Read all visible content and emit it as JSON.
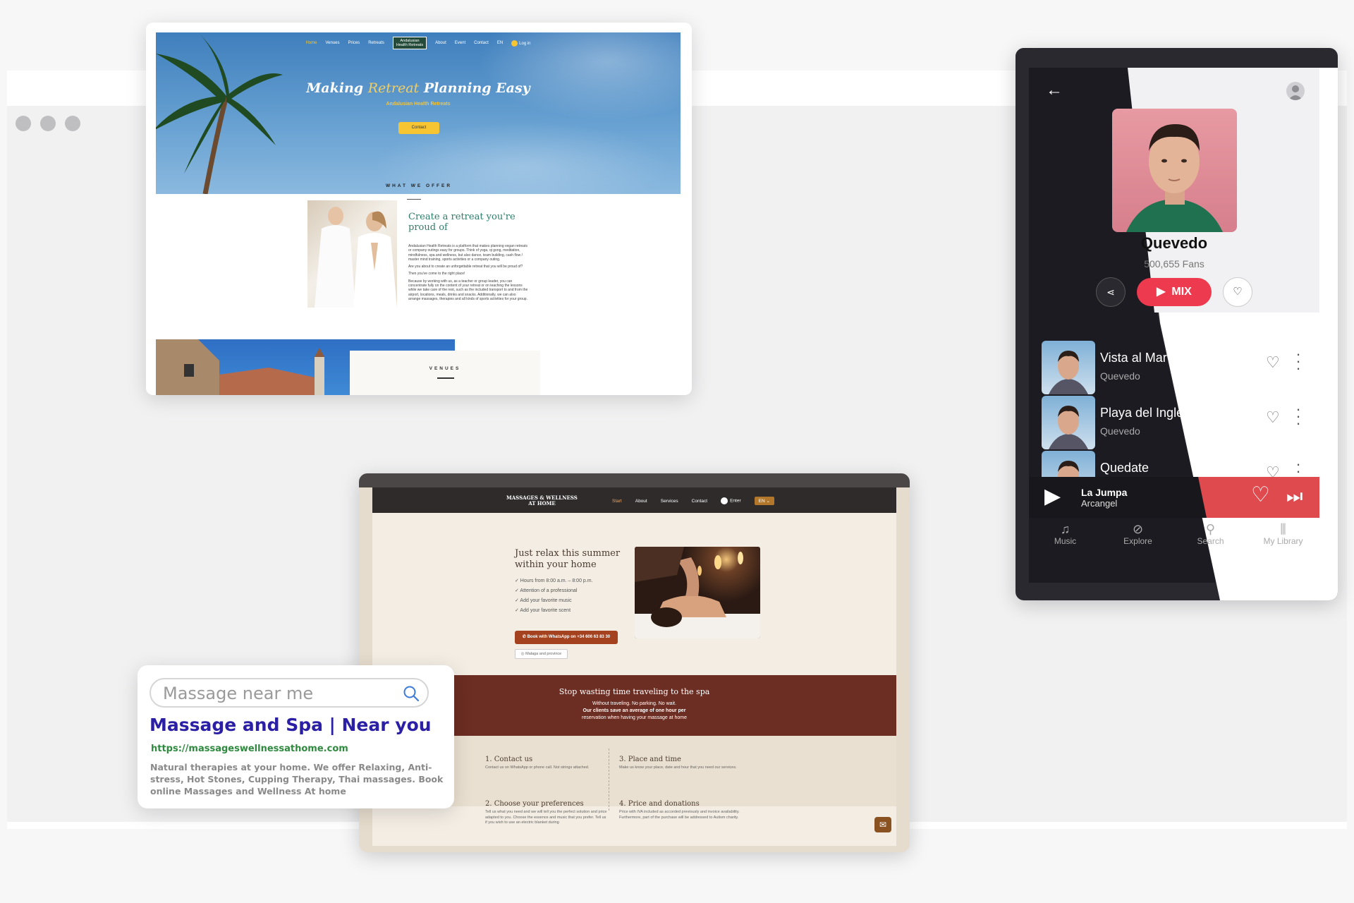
{
  "window": {
    "dots": 3
  },
  "retreat": {
    "nav": {
      "items": [
        "Home",
        "Venues",
        "Prices",
        "Retreats",
        "About",
        "Event",
        "Contact",
        "EN",
        "Log in"
      ],
      "logo_top": "Andalusian",
      "logo_bottom": "Health Retreats"
    },
    "hero": {
      "title_a": "Making ",
      "title_hl": "Retreat",
      "title_b": " Planning Easy",
      "subtitle": "Andalusian Health Retreats",
      "cta": "Contact"
    },
    "offer_label": "WHAT WE OFFER",
    "heading": "Create a retreat you're proud of",
    "paragraphs": [
      "Andalusian Health Retreats is a platform that makes planning vegan retreats or company outings easy for groups. Think of yoga, qi gong, meditation, mindfulness, spa and wellness, but also dance, team building, cash flow / master mind training, sports activities or a company outing.",
      "Are you about to create an unforgettable retreat that you will be proud of?",
      "Then you've come to the right place!",
      "Because by working with us, as a teacher or group leader, you can concentrate fully on the content of your retreat or on teaching the lessons while we take care of the rest, such as the included transport to and from the airport, locations, meals, drinks and snacks. Additionally, we can also arrange massages, therapies and all kinds of sports activities for your group."
    ],
    "venues_label": "VENUES"
  },
  "massage": {
    "brand_top": "MASSAGES & WELLNESS",
    "brand_bottom": "AT HOME",
    "nav": {
      "start": "Start",
      "about": "About",
      "services": "Services",
      "contact": "Contact",
      "enter": "Enter",
      "lang": "EN"
    },
    "headline": "Just relax this summer within your home",
    "checklist": [
      "✓ Hours from 8:00 a.m. – 8:00 p.m.",
      "✓ Attention of a professional",
      "✓ Add your favorite music",
      "✓ Add your favorite scent"
    ],
    "whatsapp": "Book with WhatsApp on +34 606 63 83 30",
    "location": "Malaga and province",
    "band_title": "Stop wasting time traveling to the spa",
    "band_line1": "Without traveling. No parking. No wait.",
    "band_line2": "Our clients save an average of one hour per",
    "band_line3": "reservation when having your massage at home",
    "steps": [
      {
        "title": "1.  Contact us",
        "text": "Contact us on WhatsApp or phone call. Not strings attached."
      },
      {
        "title": "3.  Place and time",
        "text": "Make us know your place, date and hour that you need our services."
      },
      {
        "title": "2.  Choose your preferences",
        "text": "Tell us what you need and we will tell you the perfect solution and price adapted to you. Choose the essence and music that you prefer. Tell us if you wish to use an electric blanket during"
      },
      {
        "title": "4.  Price and donations",
        "text": "Price with IVA included as accorded previously and invoice availability. Furthermore, part of the purchase will be addressed to Autism charity."
      }
    ]
  },
  "search": {
    "placeholder": "Massage near me",
    "title": "Massage and Spa | Near you",
    "url": "https://massageswellnessathome.com",
    "description": "Natural therapies at your home. We offer Relaxing, Anti-stress, Hot Stones, Cupping Therapy, Thai massages. Book online Massages and Wellness At home"
  },
  "music": {
    "artist": "Quevedo",
    "fans": "500,655 Fans",
    "mix": "MIX",
    "tracks": [
      {
        "title": "Vista al Mar",
        "artist": "Quevedo"
      },
      {
        "title": "Playa del Inglés",
        "artist": "Quevedo"
      },
      {
        "title": "Quedate",
        "artist": "Quevedo"
      }
    ],
    "now_playing": {
      "title": "La Jumpa",
      "artist": "Arcangel"
    },
    "tabs": [
      "Music",
      "Explore",
      "Search",
      "My Library"
    ],
    "colors": {
      "accent": "#ed3a4f",
      "player": "#df4a4f",
      "dark": "#1b1b21"
    }
  }
}
